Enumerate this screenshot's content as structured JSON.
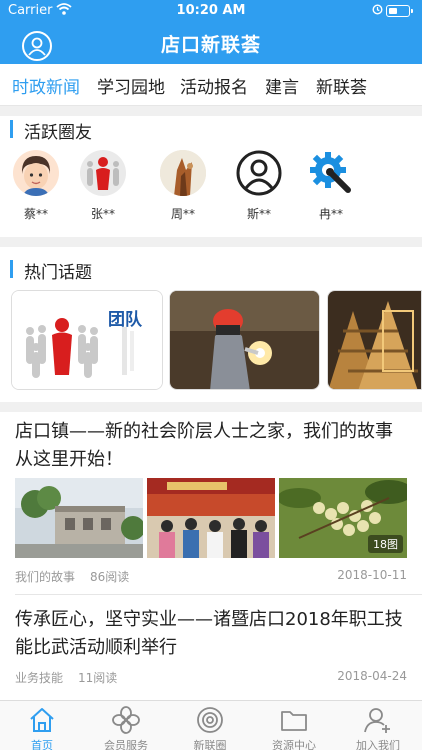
{
  "status_bar": {
    "carrier": "Carrier",
    "time": "10:20 AM"
  },
  "header": {
    "title": "店口新联荟"
  },
  "tabs": [
    {
      "label": "时政新闻",
      "active": true
    },
    {
      "label": "学习园地"
    },
    {
      "label": "活动报名"
    },
    {
      "label": "建言"
    },
    {
      "label": "新联荟"
    }
  ],
  "active_friends": {
    "title": "活跃圈友",
    "members": [
      {
        "name": "蔡**",
        "icon": "cartoon-man-avatar"
      },
      {
        "name": "张**",
        "icon": "red-figure-team-avatar"
      },
      {
        "name": "周**",
        "icon": "photo-avatar"
      },
      {
        "name": "斯**",
        "icon": "default-user-avatar"
      },
      {
        "name": "冉**",
        "icon": "gear-wrench-avatar"
      }
    ]
  },
  "hot_topics": {
    "title": "热门话题",
    "team_image_text": "团队"
  },
  "articles": [
    {
      "title": "店口镇——新的社会阶层人士之家，我们的故事从这里开始！",
      "category": "我们的故事",
      "reads": "86阅读",
      "date": "2018-10-11",
      "image_count": "18图"
    },
    {
      "title": "传承匠心，坚守实业——诸暨店口2018年职工技能比武活动顺利举行",
      "category": "业务技能",
      "reads": "11阅读",
      "date": "2018-04-24"
    }
  ],
  "tab_bar": [
    {
      "label": "首页",
      "icon": "home-icon",
      "active": true
    },
    {
      "label": "会员服务",
      "icon": "clover-icon"
    },
    {
      "label": "新联圈",
      "icon": "circle-icon"
    },
    {
      "label": "资源中心",
      "icon": "folder-icon"
    },
    {
      "label": "加入我们",
      "icon": "add-user-icon"
    }
  ],
  "colors": {
    "accent": "#2f9ef0",
    "header_bg": "#2f9ef0"
  }
}
